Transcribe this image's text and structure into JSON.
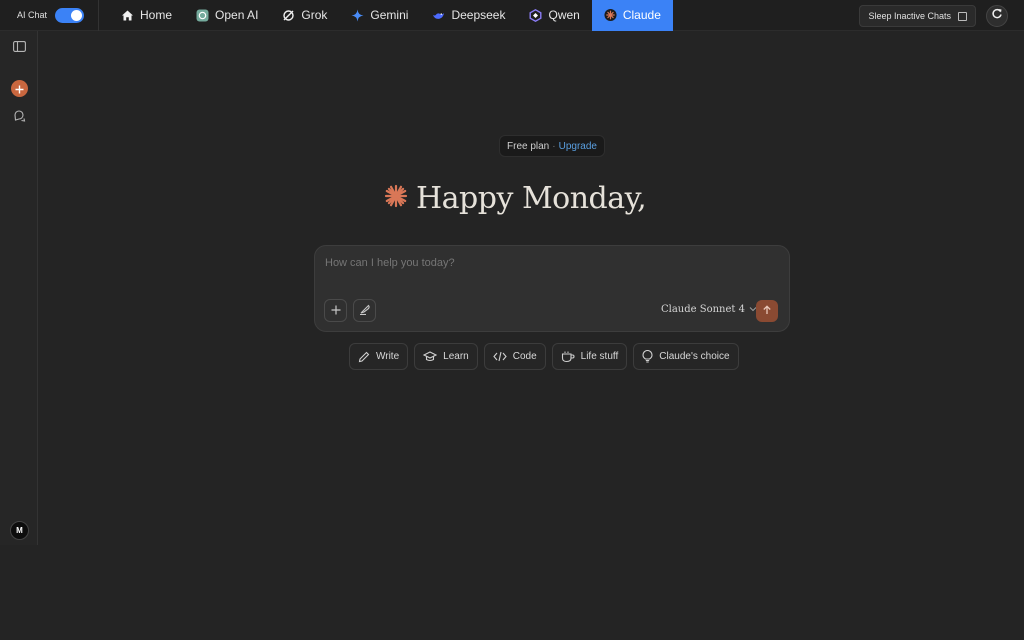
{
  "topbar": {
    "ai_chat_label": "AI Chat",
    "ai_chat_enabled": true,
    "tabs": [
      {
        "label": "Home",
        "icon": "home-icon"
      },
      {
        "label": "Open AI",
        "icon": "openai-icon"
      },
      {
        "label": "Grok",
        "icon": "grok-icon"
      },
      {
        "label": "Gemini",
        "icon": "gemini-icon"
      },
      {
        "label": "Deepseek",
        "icon": "deepseek-icon"
      },
      {
        "label": "Qwen",
        "icon": "qwen-icon"
      },
      {
        "label": "Claude",
        "icon": "claude-icon",
        "active": true
      }
    ],
    "sleep_label": "Sleep Inactive Chats",
    "sleep_checked": false
  },
  "sidebar": {
    "avatar_initial": "M"
  },
  "main": {
    "plan_label": "Free plan",
    "plan_separator": "·",
    "upgrade_label": "Upgrade",
    "greeting": "Happy Monday,",
    "input_placeholder": "How can I help you today?",
    "model_label": "Claude Sonnet 4",
    "chips": [
      {
        "label": "Write",
        "icon": "pencil-icon"
      },
      {
        "label": "Learn",
        "icon": "graduation-cap-icon"
      },
      {
        "label": "Code",
        "icon": "code-icon"
      },
      {
        "label": "Life stuff",
        "icon": "coffee-cup-icon"
      },
      {
        "label": "Claude's choice",
        "icon": "lightbulb-icon"
      }
    ]
  },
  "colors": {
    "accent_blue": "#3b82f6",
    "claude_orange": "#d97757",
    "send_button": "#8a4a32",
    "upgrade_link": "#5a9fe0"
  }
}
